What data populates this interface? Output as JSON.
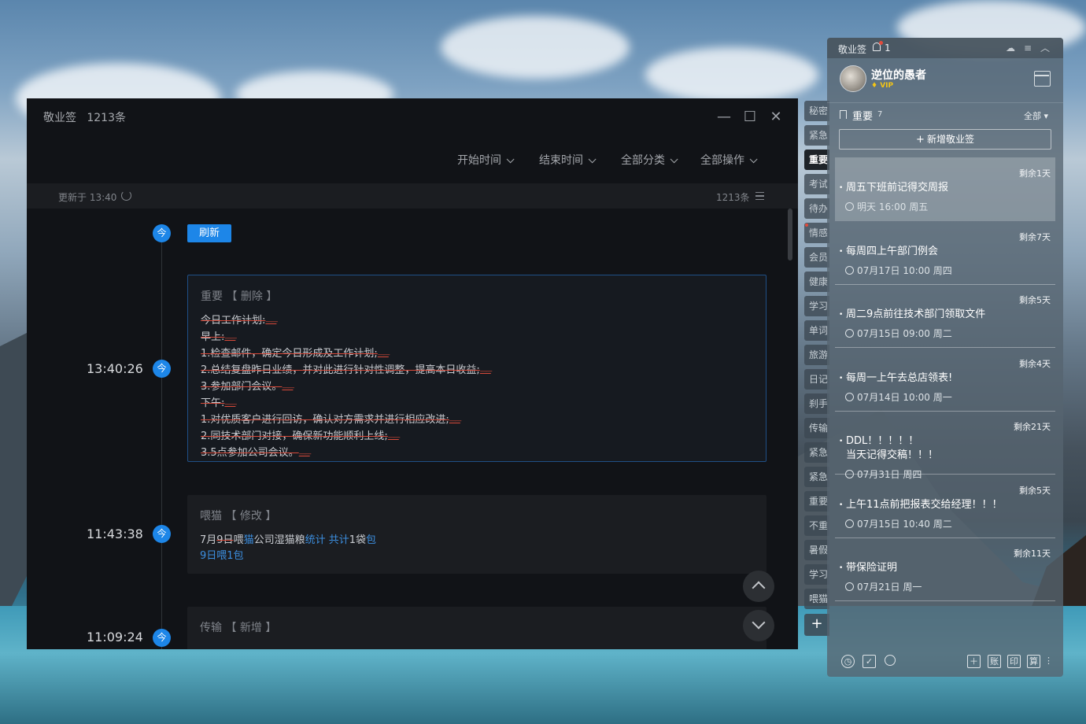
{
  "main_window": {
    "app_name": "敬业签",
    "count_label": "1213条",
    "filters": [
      "开始时间",
      "结束时间",
      "全部分类",
      "全部操作"
    ],
    "status": {
      "updated": "更新于 13:40",
      "count": "1213条"
    },
    "refresh_label": "刷新",
    "node_label": "今",
    "entries": [
      {
        "time": "13:40:26",
        "head": "重要",
        "action": "删除",
        "lines": [
          "今日工作计划:",
          "早上:",
          "1.检查邮件，确定今日形成及工作计划;",
          "2.总结复盘昨日业绩，并对此进行针对性调整，提高本日收益;",
          "3.参加部门会议。",
          "下午:",
          "1.对优质客户进行回访，确认对方需求并进行相应改进;",
          "2.同技术部门对接，确保新功能顺利上线;",
          "3.5点参加公司会议。"
        ]
      },
      {
        "time": "11:43:38",
        "head": "喂猫",
        "action": "修改",
        "segments": [
          {
            "text": "7月",
            "style": "normal"
          },
          {
            "text": "9日",
            "style": "del"
          },
          {
            "text": "喂",
            "style": "normal"
          },
          {
            "text": "猫",
            "style": "add"
          },
          {
            "text": "公司湿猫粮",
            "style": "normal"
          },
          {
            "text": "统计",
            "style": "add"
          },
          {
            "text": " 共计",
            "style": "add"
          },
          {
            "text": "1袋",
            "style": "normal"
          },
          {
            "text": "包",
            "style": "add"
          }
        ],
        "line2": "9日喂1包"
      },
      {
        "time": "11:09:24",
        "head": "传输",
        "action": "新增"
      }
    ]
  },
  "side_tabs": [
    "秘密",
    "紧急",
    "重要",
    "考试",
    "待办",
    "情感",
    "会员",
    "健康",
    "学习",
    "单词",
    "旅游",
    "日记",
    "刹手",
    "传输",
    "紧急",
    "紧急",
    "重要",
    "不重",
    "暑假",
    "学习",
    "喂猫"
  ],
  "side_active_index": 2,
  "side_dot_index": 5,
  "panel": {
    "app_name": "敬业签",
    "notify_count": "1",
    "user_name": "逆位的愚者",
    "vip_label": "VIP",
    "category": "重要",
    "category_count": "7",
    "filter_all": "全部",
    "add_label": "新增敬业签",
    "todos": [
      {
        "remain": "剩余1天",
        "title": "周五下班前记得交周报",
        "meta": "明天 16:00 周五",
        "icon": "repeat-icon"
      },
      {
        "remain": "剩余7天",
        "title": "每周四上午部门例会",
        "meta": "07月17日 10:00 周四",
        "icon": "repeat-icon"
      },
      {
        "remain": "剩余5天",
        "title": "周二9点前往技术部门领取文件",
        "meta": "07月15日 09:00 周二",
        "icon": "repeat-icon"
      },
      {
        "remain": "剩余4天",
        "title": "每周一上午去总店领表!",
        "meta": "07月14日 10:00 周一",
        "icon": "repeat-icon"
      },
      {
        "remain": "剩余21天",
        "title": "DDL！！！！！",
        "title2": "当天记得交稿！！！",
        "meta": "07月31日 周四",
        "icon": "clock-icon"
      },
      {
        "remain": "剩余5天",
        "title": "上午11点前把报表交给经理！！！",
        "meta": "07月15日 10:40 周二",
        "icon": "repeat-icon"
      },
      {
        "remain": "剩余11天",
        "title": "带保险证明",
        "meta": "07月21日 周一",
        "icon": "repeat-icon"
      }
    ],
    "bottom_icons": [
      "clock-icon",
      "calendar-check-icon",
      "search-icon",
      "add-note-icon",
      "ledger-icon",
      "print-icon",
      "calc-icon"
    ],
    "bottom_glyphs": [
      "＋",
      "账",
      "印",
      "算"
    ]
  }
}
